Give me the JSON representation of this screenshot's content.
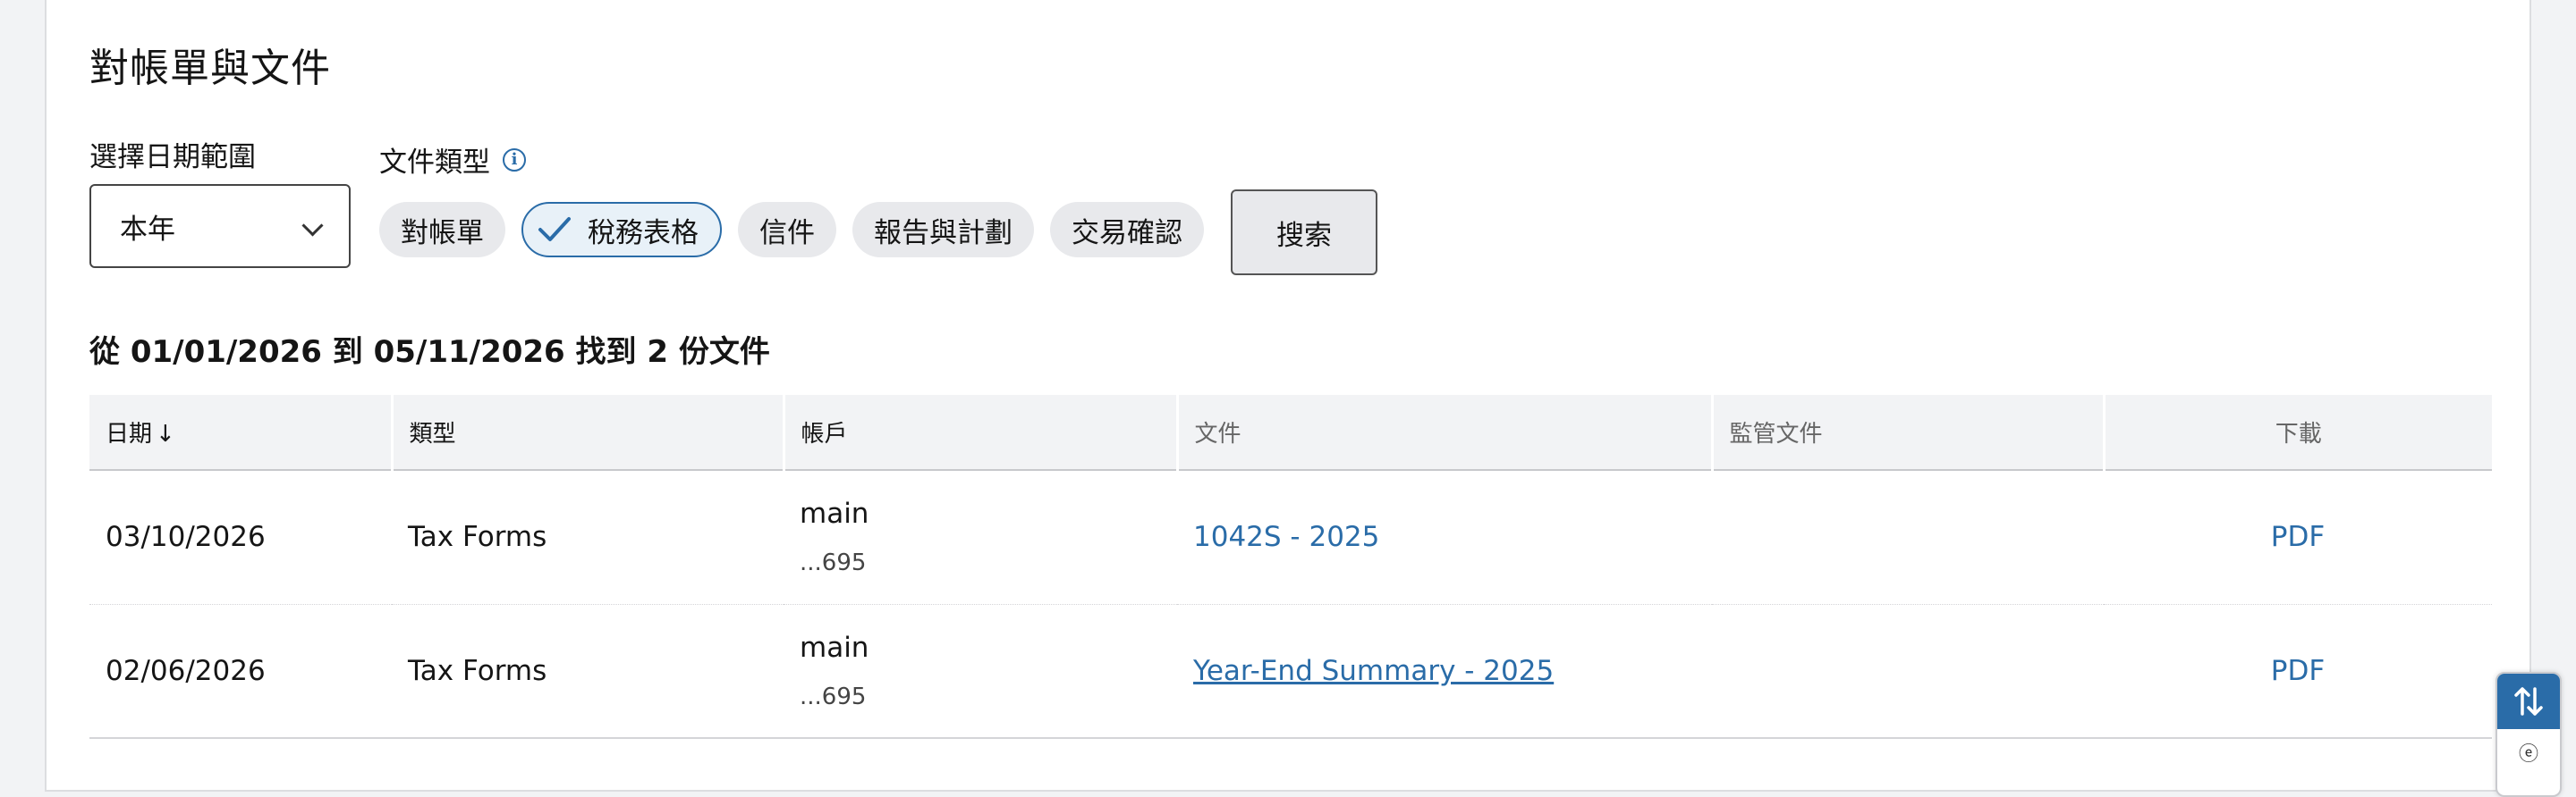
{
  "page": {
    "title": "對帳單與文件"
  },
  "filters": {
    "date_label": "選擇日期範圍",
    "date_value": "本年",
    "type_label": "文件類型",
    "info_icon": "i",
    "chips": [
      {
        "label": "對帳單",
        "selected": false
      },
      {
        "label": "稅務表格",
        "selected": true
      },
      {
        "label": "信件",
        "selected": false
      },
      {
        "label": "報告與計劃",
        "selected": false
      },
      {
        "label": "交易確認",
        "selected": false
      }
    ],
    "search_label": "搜索"
  },
  "results": {
    "summary": "從 01/01/2026 到 05/11/2026 找到 2 份文件"
  },
  "table": {
    "headers": {
      "date": "日期",
      "date_sort": "↓",
      "type": "類型",
      "account": "帳戶",
      "document": "文件",
      "regulatory": "監管文件",
      "download": "下載"
    },
    "rows": [
      {
        "date": "03/10/2026",
        "type": "Tax Forms",
        "account_name": "main",
        "account_num": "...695",
        "document": "1042S - 2025",
        "regulatory": "",
        "download": "PDF"
      },
      {
        "date": "02/06/2026",
        "type": "Tax Forms",
        "account_name": "main",
        "account_num": "...695",
        "document": "Year-End Summary - 2025",
        "regulatory": "",
        "download": "PDF"
      }
    ]
  },
  "floating_widget": {
    "icon": "sort-arrows-icon",
    "secondary_glyph": "ⓔ"
  },
  "colors": {
    "accent": "#2a6ca8",
    "chip_bg": "#e8e9ec",
    "header_bg": "#f2f3f5"
  }
}
